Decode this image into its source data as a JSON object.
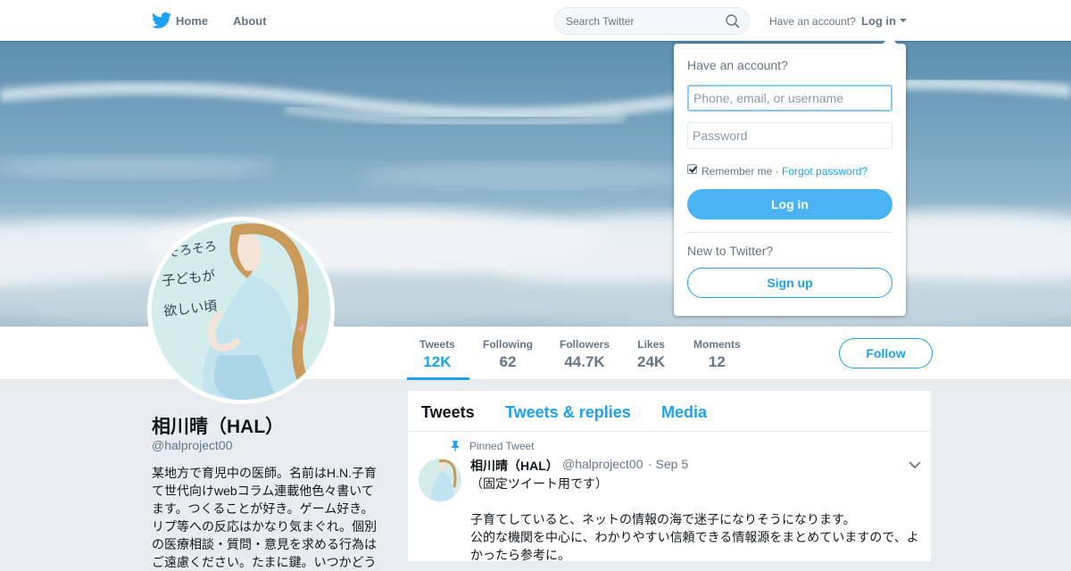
{
  "nav": {
    "home_label": "Home",
    "about_label": "About",
    "search_placeholder": "Search Twitter",
    "have_account": "Have an account?",
    "login_label": "Log in"
  },
  "stats": [
    {
      "label": "Tweets",
      "value": "12K"
    },
    {
      "label": "Following",
      "value": "62"
    },
    {
      "label": "Followers",
      "value": "44.7K"
    },
    {
      "label": "Likes",
      "value": "24K"
    },
    {
      "label": "Moments",
      "value": "12"
    }
  ],
  "follow_label": "Follow",
  "profile": {
    "name": "相川晴（HAL）",
    "handle": "@halproject00",
    "bio": "某地方で育児中の医師。名前はH.N.子育\nて世代向けwebコラム連載他色々書いて\nます。つくることが好き。ゲーム好き。\nリプ等への反応はかなり気まぐれ。個別\nの医療相談・質問・意見を求める行為は\nご遠慮ください。たまに鍵。いつかどう"
  },
  "avatar_text": "そろそろ 子どもが 欲しい頃",
  "timeline": {
    "tabs": [
      "Tweets",
      "Tweets & replies",
      "Media"
    ],
    "pinned_label": "Pinned Tweet",
    "tweet": {
      "name": "相川晴（HAL）",
      "handle": "@halproject00",
      "date": "· Sep 5",
      "text": "（固定ツイート用です）\n\n子育てしていると、ネットの情報の海で迷子になりそうになります。\n公的な機関を中心に、わかりやすい信頼できる情報源をまとめていますので、よかったら参考に。"
    }
  },
  "login_dropdown": {
    "title": "Have an account?",
    "username_placeholder": "Phone, email, or username",
    "password_placeholder": "Password",
    "remember_label": "Remember me ·",
    "forgot_label": "Forgot password?",
    "login_button": "Log in",
    "new_label": "New to Twitter?",
    "signup_button": "Sign up",
    "remember_checked": true
  },
  "colors": {
    "accent": "#1da1f2",
    "login_button": "#4ab3f4",
    "background": "#e6ecf0"
  },
  "icons": [
    "twitter-bird-icon",
    "search-icon",
    "caret-down-icon",
    "pin-icon",
    "chevron-down-icon"
  ]
}
